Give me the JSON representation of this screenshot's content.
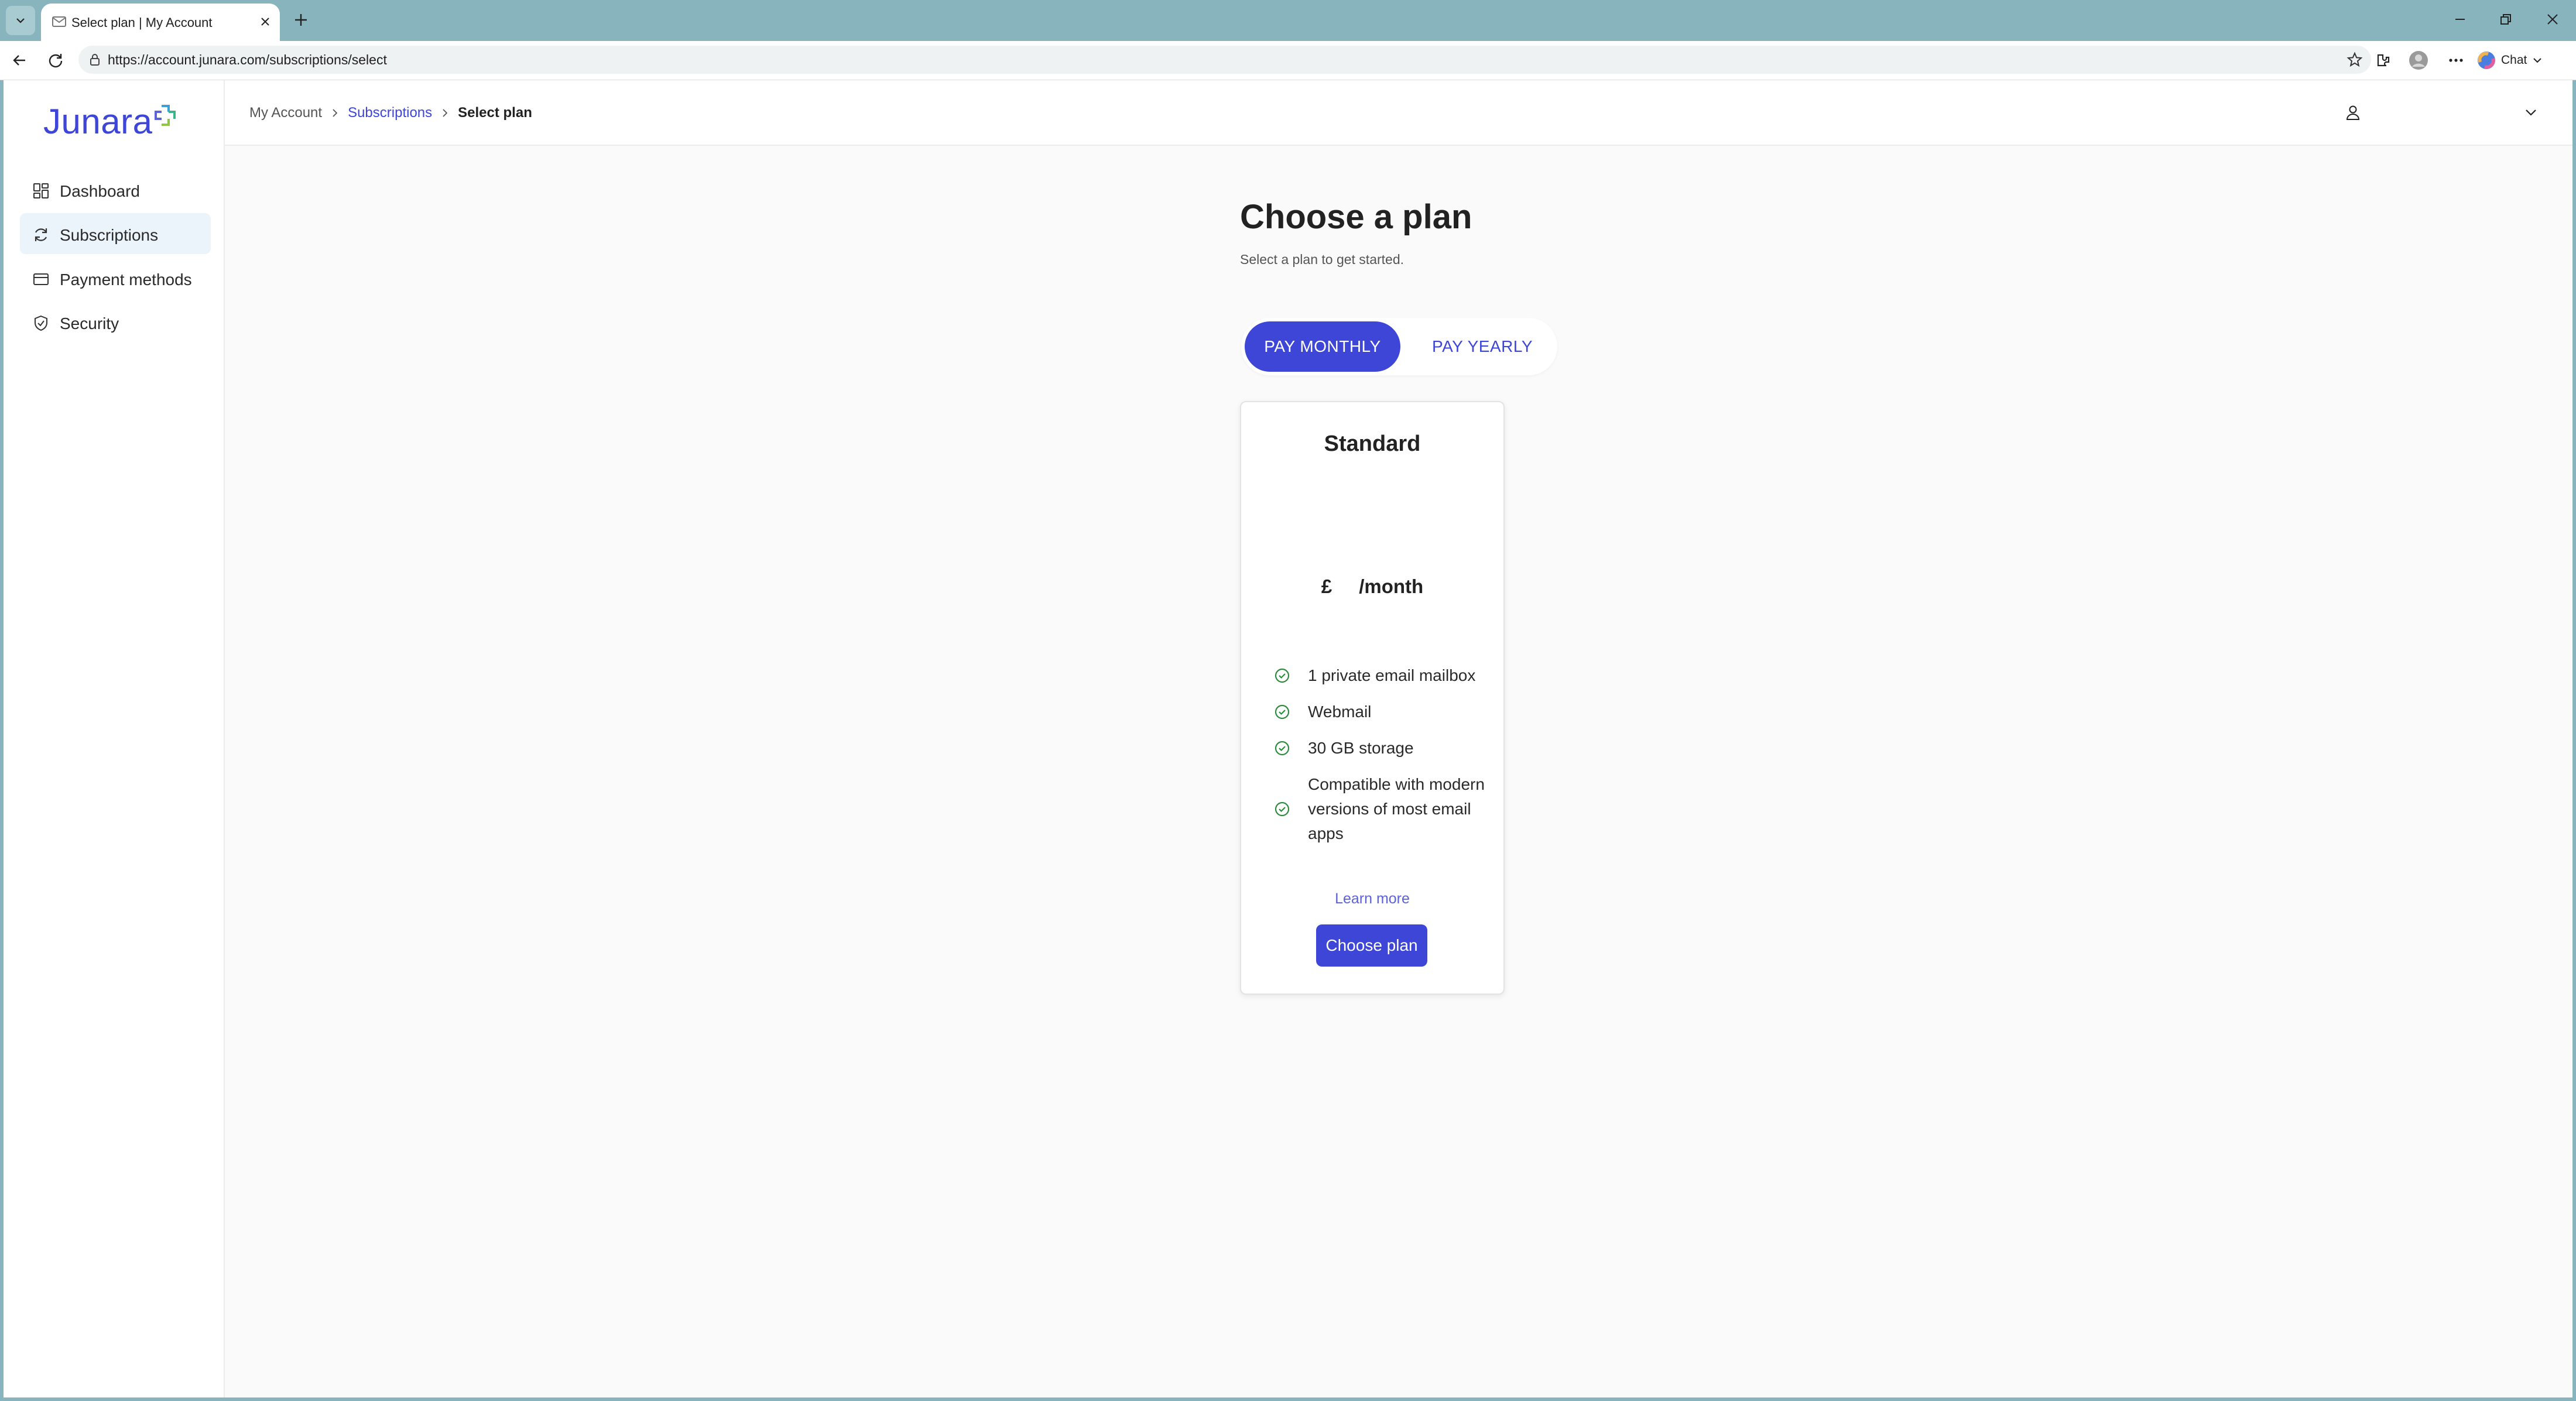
{
  "browser": {
    "tab_title": "Select plan | My Account",
    "url": "https://account.junara.com/subscriptions/select",
    "chat_label": "Chat"
  },
  "app": {
    "logo_text": "Junara",
    "colors": {
      "accent": "#3d46d6",
      "check": "#2e8b3e",
      "active_nav_bg": "#ebf3fb"
    }
  },
  "sidebar": {
    "items": [
      {
        "label": "Dashboard",
        "icon": "dashboard-grid-icon",
        "active": false
      },
      {
        "label": "Subscriptions",
        "icon": "refresh-icon",
        "active": true
      },
      {
        "label": "Payment methods",
        "icon": "credit-card-icon",
        "active": false
      },
      {
        "label": "Security",
        "icon": "shield-check-icon",
        "active": false
      }
    ]
  },
  "breadcrumb": {
    "items": [
      "My Account",
      "Subscriptions",
      "Select plan"
    ]
  },
  "main": {
    "title": "Choose a plan",
    "subtitle": "Select a plan to get started.",
    "billing_toggle": {
      "monthly_label": "PAY MONTHLY",
      "yearly_label": "PAY YEARLY",
      "selected": "monthly"
    },
    "plan": {
      "name": "Standard",
      "currency": "£",
      "amount": "",
      "period": "/month",
      "features": [
        "1 private email mailbox",
        "Webmail",
        "30 GB storage",
        "Compatible with modern versions of most email apps"
      ],
      "learn_more": "Learn more",
      "cta": "Choose plan"
    }
  }
}
